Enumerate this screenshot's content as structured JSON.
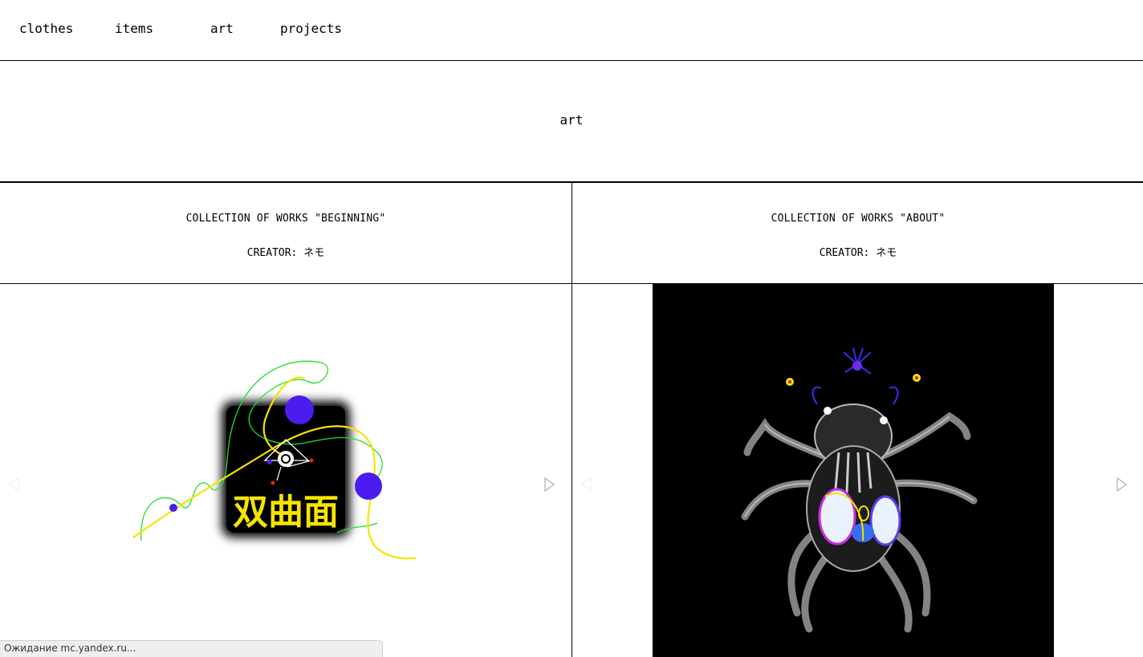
{
  "nav": {
    "items": [
      {
        "label": "clothes"
      },
      {
        "label": "items"
      },
      {
        "label": "art"
      },
      {
        "label": "projects"
      }
    ]
  },
  "section": {
    "title": "art"
  },
  "collections": [
    {
      "title": "COLLECTION OF WORKS \"BEGINNING\"",
      "creator": "CREATOR: ネモ",
      "artwork_text": "双曲面",
      "prev_icon": "triangle-left-icon",
      "next_icon": "triangle-right-icon"
    },
    {
      "title": "COLLECTION OF WORKS \"ABOUT\"",
      "creator": "CREATOR: ネモ",
      "prev_icon": "triangle-left-icon",
      "next_icon": "triangle-right-icon"
    }
  ],
  "colors": {
    "artwork_yellow": "#f5e400",
    "artwork_green": "#22dd33",
    "artwork_violet": "#4a1cf0",
    "artwork_bg_black": "#000000"
  },
  "status_bar": {
    "text": "Ожидание mc.yandex.ru..."
  }
}
